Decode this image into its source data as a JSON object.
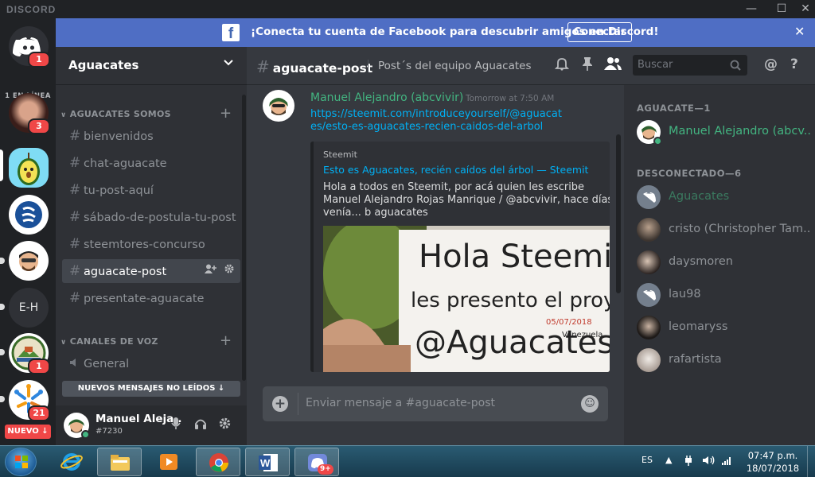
{
  "window": {
    "brand": "DISCORD",
    "minimize": "—",
    "maximize": "☐",
    "close": "✕"
  },
  "notice": {
    "text": "¡Conecta tu cuenta de Facebook para descubrir amigos en Discord!",
    "button": "Conectar",
    "close": "✕",
    "fb_letter": "f"
  },
  "rail": {
    "online_count": "1 EN LÍNEA",
    "home_badge": "1",
    "dm_badge": "3",
    "eh_label": "E-H",
    "maracay_badge": "1",
    "people_badge": "21",
    "nuevo": "NUEVO ↓"
  },
  "guild": {
    "name": "Aguacates",
    "chevron": "⌄",
    "text_category": "AGUACATES SOMOS",
    "voice_category": "CANALES DE VOZ",
    "add": "+",
    "channels": [
      {
        "name": "bienvenidos"
      },
      {
        "name": "chat-aguacate"
      },
      {
        "name": "tu-post-aquí"
      },
      {
        "name": "sábado-de-postula-tu-post"
      },
      {
        "name": "steemtores-concurso"
      },
      {
        "name": "aguacate-post"
      },
      {
        "name": "presentate-aguacate"
      }
    ],
    "voice_channels": [
      {
        "name": "General"
      }
    ],
    "new_messages": "NUEVOS MENSAJES NO LEÍDOS ↓",
    "hash": "#",
    "caret": "⌄"
  },
  "user": {
    "name": "Manuel Aleja..",
    "tag": "#7230"
  },
  "chat": {
    "channel": "aguacate-post",
    "topic": "Post´s del equipo Aguacates",
    "search_placeholder": "Buscar",
    "message": {
      "author": "Manuel Alejandro (abcvivir)",
      "timestamp": "Tomorrow at 7:50 AM",
      "link_line1": "https://steemit.com/introduceyourself/@aguacat",
      "link_line2": "es/esto-es-aguacates-recien-caidos-del-arbol",
      "embed": {
        "provider": "Steemit",
        "title": "Esto es Aguacates, recién caídos del árbol — Steemit",
        "description": "Hola a todos en Steemit, por acá quien les escribe Manuel Alejandro Rojas Manrique / @abcvivir, hace días venía... b aguacates",
        "image_lines": [
          "Hola Steemit",
          "les presento el proyecto",
          "@Aguacates"
        ],
        "image_date": "05/07/2018",
        "image_country": "Venezuela"
      }
    },
    "composer_placeholder": "Enviar mensaje a #aguacate-post"
  },
  "members": {
    "online_header": "AGUACATE—1",
    "offline_header": "DESCONECTADO—6",
    "online": [
      {
        "name": "Manuel Alejandro (abcv..",
        "color": "#43b581"
      }
    ],
    "offline": [
      {
        "name": "Aguacates",
        "color": "#43b581"
      },
      {
        "name": "cristo (Christopher Tam..",
        "color": "#8e9297"
      },
      {
        "name": "daysmoren",
        "color": "#8e9297"
      },
      {
        "name": "lau98",
        "color": "#8e9297"
      },
      {
        "name": "leomaryss",
        "color": "#8e9297"
      },
      {
        "name": "rafartista",
        "color": "#8e9297"
      }
    ]
  },
  "taskbar": {
    "lang": "ES",
    "time": "07:47 p.m.",
    "date": "18/07/2018",
    "discord_badge": "9+"
  },
  "colors": {
    "blurple": "#7289da",
    "online": "#43b581",
    "badge": "#f04747",
    "link": "#00b0f4"
  }
}
